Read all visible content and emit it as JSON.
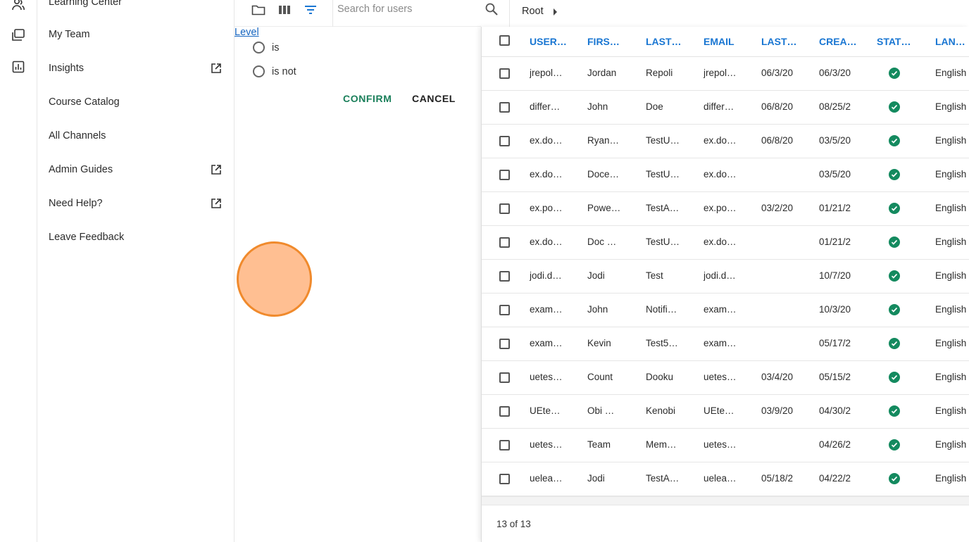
{
  "rail": {
    "icons": [
      "users-icon",
      "library-icon",
      "chart-icon"
    ]
  },
  "menu": {
    "items": [
      {
        "label": "Learning Center",
        "external": false
      },
      {
        "label": "My Team",
        "external": false
      },
      {
        "label": "Insights",
        "external": true
      },
      {
        "label": "Course Catalog",
        "external": false
      },
      {
        "label": "All Channels",
        "external": false
      },
      {
        "label": "Admin Guides",
        "external": true
      },
      {
        "label": "Need Help?",
        "external": true
      },
      {
        "label": "Leave Feedback",
        "external": false
      }
    ]
  },
  "filter": {
    "search_placeholder": "Search for users",
    "field_link": "Level",
    "options": [
      "is",
      "is not"
    ],
    "confirm_label": "CONFIRM",
    "cancel_label": "CANCEL"
  },
  "breadcrumb": {
    "root": "Root"
  },
  "table": {
    "columns": [
      "USER…",
      "FIRS…",
      "LAST…",
      "EMAIL",
      "LAST…",
      "CREA…",
      "STAT…",
      "LAN…"
    ],
    "rows": [
      [
        "jrepol…",
        "Jordan",
        "Repoli",
        "jrepol…",
        "06/3/20",
        "06/3/20",
        "active",
        "English"
      ],
      [
        "differ…",
        "John",
        "Doe",
        "differ…",
        "06/8/20",
        "08/25/2",
        "active",
        "English"
      ],
      [
        "ex.do…",
        "Ryana…",
        "TestU…",
        "ex.do…",
        "06/8/20",
        "03/5/20",
        "active",
        "English"
      ],
      [
        "ex.do…",
        "Doce…",
        "TestU…",
        "ex.do…",
        "",
        "03/5/20",
        "active",
        "English"
      ],
      [
        "ex.po…",
        "Powe…",
        "TestA…",
        "ex.po…",
        "03/2/20",
        "01/21/2",
        "active",
        "English"
      ],
      [
        "ex.do…",
        "Doc E…",
        "TestU…",
        "ex.do…",
        "",
        "01/21/2",
        "active",
        "English"
      ],
      [
        "jodi.d…",
        "Jodi",
        "Test",
        "jodi.d…",
        "",
        "10/7/20",
        "active",
        "English"
      ],
      [
        "exam…",
        "John",
        "Notifi…",
        "exam…",
        "",
        "10/3/20",
        "active",
        "English"
      ],
      [
        "exam…",
        "Kevin",
        "Test5…",
        "exam…",
        "",
        "05/17/2",
        "active",
        "English"
      ],
      [
        "uetes…",
        "Count",
        "Dooku",
        "uetes…",
        "03/4/20",
        "05/15/2",
        "active",
        "English"
      ],
      [
        "UEtes…",
        "Obi W…",
        "Kenobi",
        "UEtes…",
        "03/9/20",
        "04/30/2",
        "active",
        "English"
      ],
      [
        "uetes…",
        "Team",
        "Mem…",
        "uetes…",
        "",
        "04/26/2",
        "active",
        "English"
      ],
      [
        "uelea…",
        "Jodi",
        "TestA…",
        "uelea…",
        "05/18/2",
        "04/22/2",
        "active",
        "English"
      ]
    ],
    "count_label": "13 of 13"
  },
  "colors": {
    "accent": "#1976d2",
    "confirm": "#1a7f5a",
    "status_active": "#148a5f",
    "cursor_marker": "#f08a2c"
  }
}
